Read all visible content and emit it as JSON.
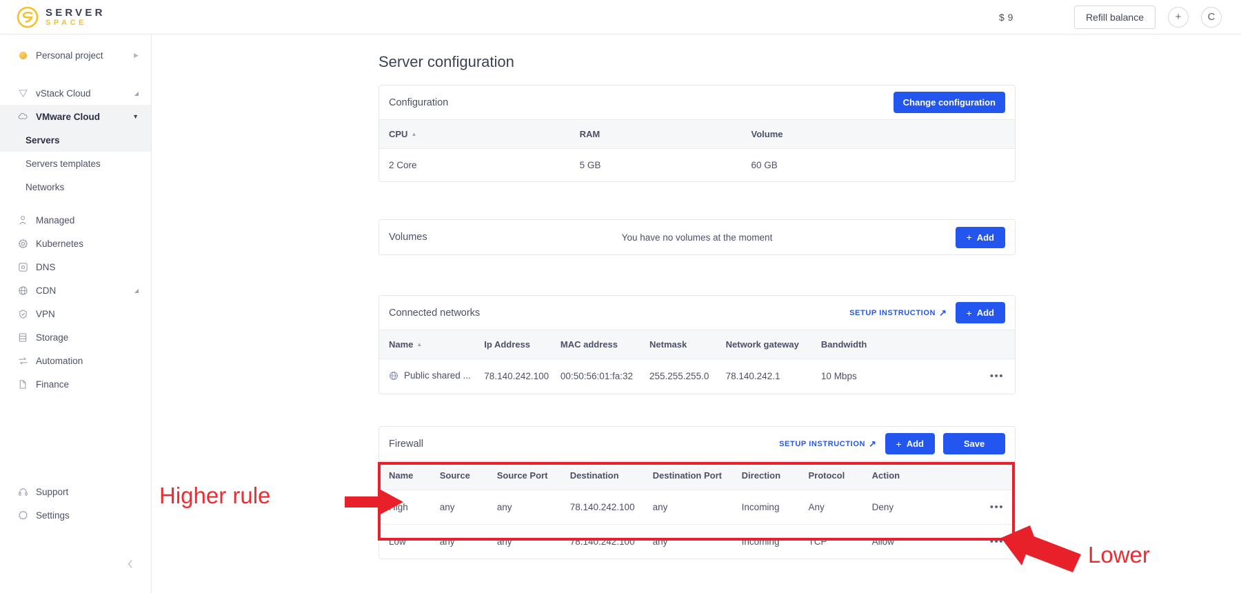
{
  "topbar": {
    "logo_top": "SERVER",
    "logo_bottom": "SPACE",
    "balance": "$ 9",
    "refill_label": "Refill balance",
    "plus_label": "+",
    "avatar_label": "C"
  },
  "sidebar": {
    "project": {
      "label": "Personal project",
      "icon": "project-dot",
      "caret": "▶"
    },
    "groups": [
      {
        "label": "vStack Cloud",
        "icon": "vstack-icon",
        "caret": "◢"
      },
      {
        "label": "VMware Cloud",
        "icon": "cloud-icon",
        "caret": "▼"
      }
    ],
    "sub_items": [
      {
        "label": "Servers",
        "active": true
      },
      {
        "label": "Servers templates",
        "active": false
      },
      {
        "label": "Networks",
        "active": false
      }
    ],
    "items": [
      {
        "label": "Managed",
        "icon": "managed-icon",
        "caret": ""
      },
      {
        "label": "Kubernetes",
        "icon": "kubernetes-icon",
        "caret": ""
      },
      {
        "label": "DNS",
        "icon": "dns-icon",
        "caret": ""
      },
      {
        "label": "CDN",
        "icon": "cdn-icon",
        "caret": "◢"
      },
      {
        "label": "VPN",
        "icon": "vpn-icon",
        "caret": ""
      },
      {
        "label": "Storage",
        "icon": "storage-icon",
        "caret": ""
      },
      {
        "label": "Automation",
        "icon": "automation-icon",
        "caret": ""
      },
      {
        "label": "Finance",
        "icon": "finance-icon",
        "caret": ""
      }
    ],
    "bottom_items": [
      {
        "label": "Support",
        "icon": "headset-icon"
      },
      {
        "label": "Settings",
        "icon": "gear-icon"
      }
    ],
    "collapse_icon": "chevron-left-icon"
  },
  "main": {
    "page_title": "Server configuration",
    "configuration": {
      "title": "Configuration",
      "change_button": "Change configuration",
      "columns": [
        "CPU",
        "RAM",
        "Volume"
      ],
      "sorted_column": "CPU",
      "rows": [
        {
          "cpu": "2 Core",
          "ram": "5 GB",
          "volume": "60 GB"
        }
      ]
    },
    "volumes": {
      "title": "Volumes",
      "empty_message": "You have no volumes at the moment",
      "add_button": "Add"
    },
    "connected_networks": {
      "title": "Connected networks",
      "setup_instruction": "SETUP INSTRUCTION",
      "add_button": "Add",
      "columns": [
        "Name",
        "Ip Address",
        "MAC address",
        "Netmask",
        "Network gateway",
        "Bandwidth"
      ],
      "sorted_column": "Name",
      "rows": [
        {
          "name": "Public shared ...",
          "ip": "78.140.242.100",
          "mac": "00:50:56:01:fa:32",
          "netmask": "255.255.255.0",
          "gateway": "78.140.242.1",
          "bandwidth": "10 Mbps",
          "menu": "•••"
        }
      ]
    },
    "firewall": {
      "title": "Firewall",
      "setup_instruction": "SETUP INSTRUCTION",
      "add_button": "Add",
      "save_button": "Save",
      "columns": [
        "Name",
        "Source",
        "Source Port",
        "Destination",
        "Destination Port",
        "Direction",
        "Protocol",
        "Action"
      ],
      "rows": [
        {
          "name": "High",
          "source": "any",
          "source_port": "any",
          "destination": "78.140.242.100",
          "destination_port": "any",
          "direction": "Incoming",
          "protocol": "Any",
          "action": "Deny",
          "menu": "•••"
        },
        {
          "name": "Low",
          "source": "any",
          "source_port": "any",
          "destination": "78.140.242.100",
          "destination_port": "any",
          "direction": "Incoming",
          "protocol": "TCP",
          "action": "Allow",
          "menu": "•••"
        }
      ]
    }
  },
  "annotations": {
    "higher_label": "Higher rule",
    "lower_label": "Lower",
    "color": "#ef2b31"
  }
}
